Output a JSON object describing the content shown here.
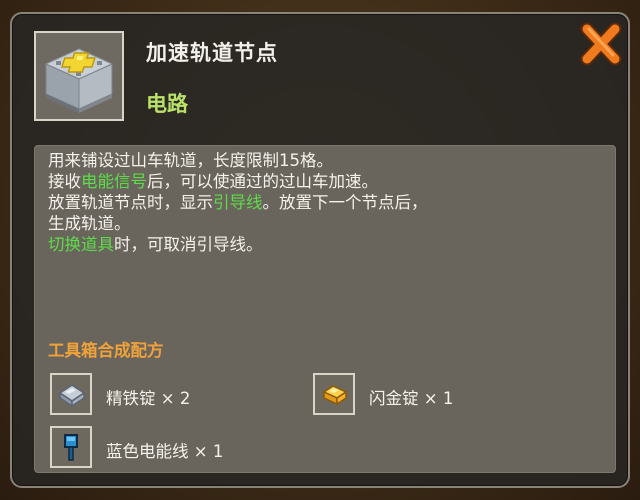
{
  "item": {
    "name": "加速轨道节点",
    "category": "电路",
    "icon": "speed-rail-node-icon"
  },
  "close": {
    "icon": "close-x-icon",
    "color": "#f07a1e"
  },
  "description": {
    "line1": "用来铺设过山车轨道，长度限制15格。",
    "line2_a": "接收",
    "line2_hl": "电能信号",
    "line2_b": "后，可以使通过的过山车加速。",
    "line3_a": "放置轨道节点时，显示",
    "line3_hl": "引导线",
    "line3_b": "。放置下一个节点后，",
    "line4": "生成轨道。",
    "line5_hl": "切换道具",
    "line5_b": "时，可取消引导线。"
  },
  "recipe": {
    "title": "工具箱合成配方",
    "ingredients": [
      {
        "label": "精铁锭 × 2",
        "icon": "iron-ingot-icon"
      },
      {
        "label": "闪金锭 × 1",
        "icon": "gold-ingot-icon"
      },
      {
        "label": "蓝色电能线 × 1",
        "icon": "blue-wire-icon"
      }
    ]
  },
  "colors": {
    "highlight": "#5ddc4a",
    "category": "#b9e26a",
    "recipe_title": "#f0a23a"
  }
}
